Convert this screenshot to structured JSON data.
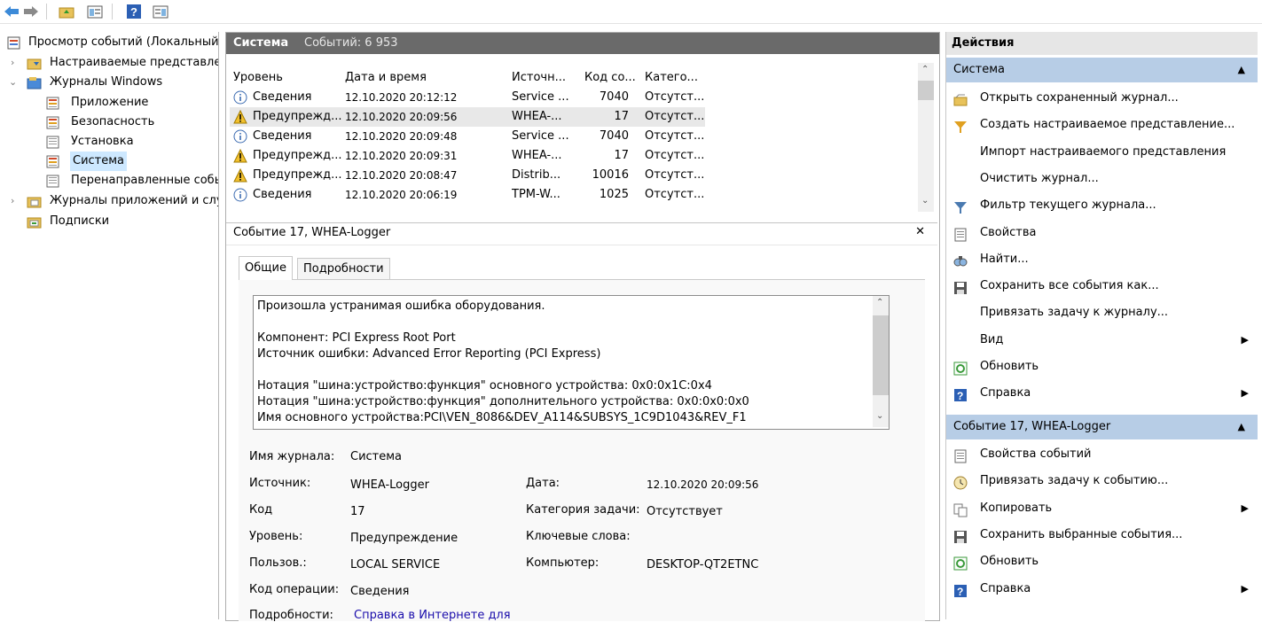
{
  "toolbar": {
    "icons": [
      "back-arrow-icon",
      "forward-arrow-icon",
      "folder-up-icon",
      "show-hide-tree-icon",
      "help-icon",
      "show-hide-actions-icon"
    ]
  },
  "tree": {
    "root": "Просмотр событий (Локальный",
    "custom_views": "Настраиваемые представлен",
    "windows_logs": "Журналы Windows",
    "items": [
      "Приложение",
      "Безопасность",
      "Установка",
      "Система",
      "Перенаправленные собы"
    ],
    "app_logs": "Журналы приложений и слу",
    "subscriptions": "Подписки"
  },
  "center": {
    "log_name": "Система",
    "event_count": "Событий: 6 953",
    "columns": [
      "Уровень",
      "Дата и время",
      "Источн...",
      "Код со...",
      "Катего..."
    ],
    "rows": [
      {
        "level": "Сведения",
        "date": "12.10.2020 20:12:12",
        "source": "Service ...",
        "code": "7040",
        "category": "Отсутст...",
        "kind": "info"
      },
      {
        "level": "Предупрежд...",
        "date": "12.10.2020 20:09:56",
        "source": "WHEA-...",
        "code": "17",
        "category": "Отсутст...",
        "kind": "warn"
      },
      {
        "level": "Сведения",
        "date": "12.10.2020 20:09:48",
        "source": "Service ...",
        "code": "7040",
        "category": "Отсутст...",
        "kind": "info"
      },
      {
        "level": "Предупрежд...",
        "date": "12.10.2020 20:09:31",
        "source": "WHEA-...",
        "code": "17",
        "category": "Отсутст...",
        "kind": "warn"
      },
      {
        "level": "Предупрежд...",
        "date": "12.10.2020 20:08:47",
        "source": "Distrib...",
        "code": "10016",
        "category": "Отсутст...",
        "kind": "warn"
      },
      {
        "level": "Сведения",
        "date": "12.10.2020 20:06:19",
        "source": "TPM-W...",
        "code": "1025",
        "category": "Отсутст...",
        "kind": "info"
      }
    ]
  },
  "detail": {
    "title": "Событие 17, WHEA-Logger",
    "close": "✕",
    "tabs": [
      "Общие",
      "Подробности"
    ],
    "description": [
      "Произошла устранимая ошибка оборудования.",
      "",
      "Компонент: PCI Express Root Port",
      "Источник ошибки: Advanced Error Reporting (PCI Express)",
      "",
      "Нотация \"шина:устройство:функция\" основного устройства: 0x0:0x1C:0x4",
      "Нотация \"шина:устройство:функция\" дополнительного устройства: 0x0:0x0:0x0",
      "Имя основного устройства:PCI\\VEN_8086&DEV_A114&SUBSYS_1C9D1043&REV_F1"
    ],
    "labels": {
      "log": "Имя журнала:",
      "source": "Источник:",
      "date": "Дата:",
      "code": "Код",
      "task": "Категория задачи:",
      "level": "Уровень:",
      "keywords": "Ключевые слова:",
      "user": "Пользов.:",
      "computer": "Компьютер:",
      "opcode": "Код операции:",
      "more": "Подробности:"
    },
    "values": {
      "log": "Система",
      "source": "WHEA-Logger",
      "date": "12.10.2020 20:09:56",
      "code": "17",
      "task": "Отсутствует",
      "level": "Предупреждение",
      "user": "LOCAL SERVICE",
      "computer": "DESKTOP-QT2ETNC",
      "opcode": "Сведения",
      "more_link": "Справка в Интернете для"
    }
  },
  "actions": {
    "header": "Действия",
    "section1": "Система",
    "section1_items": [
      {
        "label": "Открыть сохраненный журнал...",
        "icon": "open-folder-icon"
      },
      {
        "label": "Создать настраиваемое представление...",
        "icon": "filter-create-icon"
      },
      {
        "label": "Импорт настраиваемого представления",
        "icon": ""
      },
      {
        "label": "Очистить журнал...",
        "icon": ""
      },
      {
        "label": "Фильтр текущего журнала...",
        "icon": "filter-icon"
      },
      {
        "label": "Свойства",
        "icon": "properties-icon"
      },
      {
        "label": "Найти...",
        "icon": "find-icon"
      },
      {
        "label": "Сохранить все события как...",
        "icon": "save-icon"
      },
      {
        "label": "Привязать задачу к журналу...",
        "icon": ""
      },
      {
        "label": "Вид",
        "icon": "",
        "sub": true
      },
      {
        "label": "Обновить",
        "icon": "refresh-icon"
      },
      {
        "label": "Справка",
        "icon": "help-icon",
        "sub": true
      }
    ],
    "section2": "Событие 17, WHEA-Logger",
    "section2_items": [
      {
        "label": "Свойства событий",
        "icon": "properties-icon"
      },
      {
        "label": "Привязать задачу к событию...",
        "icon": "task-icon"
      },
      {
        "label": "Копировать",
        "icon": "copy-icon",
        "sub": true
      },
      {
        "label": "Сохранить выбранные события...",
        "icon": "save-icon"
      },
      {
        "label": "Обновить",
        "icon": "refresh-icon"
      },
      {
        "label": "Справка",
        "icon": "help-icon",
        "sub": true
      }
    ],
    "collapse_glyph": "▲",
    "submenu_glyph": "▶"
  },
  "colors": {
    "selected_row": "#e8e8e8",
    "section_header": "#b7cde6",
    "header_bar": "#6a6a6a",
    "link": "#1a0dab"
  }
}
